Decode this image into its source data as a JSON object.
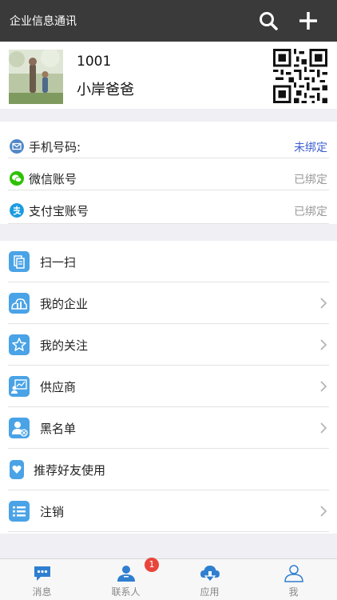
{
  "header": {
    "title": "企业信息通讯",
    "icons": [
      "search-icon",
      "plus-icon"
    ]
  },
  "profile": {
    "id": "1001",
    "name": "小岸爸爸"
  },
  "bindings": [
    {
      "label": "手机号码:",
      "status": "未绑定",
      "icon": "envelope-icon",
      "status_color": "#3e5fd1"
    },
    {
      "label": "微信账号",
      "status": "已绑定",
      "icon": "wechat-icon",
      "status_color": "#999999"
    },
    {
      "label": "支付宝账号",
      "status": "已绑定",
      "icon": "alipay-icon",
      "status_color": "#999999"
    }
  ],
  "menu": [
    {
      "label": "扫一扫",
      "icon": "scan-icon",
      "chevron": false
    },
    {
      "label": "我的企业",
      "icon": "enterprise-icon",
      "chevron": true
    },
    {
      "label": "我的关注",
      "icon": "star-icon",
      "chevron": true
    },
    {
      "label": "供应商",
      "icon": "supplier-icon",
      "chevron": true
    },
    {
      "label": "黑名单",
      "icon": "blacklist-icon",
      "chevron": true
    },
    {
      "label": "推荐好友使用",
      "icon": "heart-icon",
      "chevron": false
    },
    {
      "label": "注销",
      "icon": "list-icon",
      "chevron": true
    }
  ],
  "tabs": [
    {
      "label": "消息",
      "icon": "message-icon",
      "active": false
    },
    {
      "label": "联系人",
      "icon": "contacts-icon",
      "active": false,
      "badge": "1"
    },
    {
      "label": "应用",
      "icon": "apps-icon",
      "active": false
    },
    {
      "label": "我",
      "icon": "me-icon",
      "active": true
    }
  ],
  "colors": {
    "topbar": "#3a3a3a",
    "accent": "#4aa3e6",
    "unbound": "#3e5fd1",
    "badge": "#e8453c"
  }
}
